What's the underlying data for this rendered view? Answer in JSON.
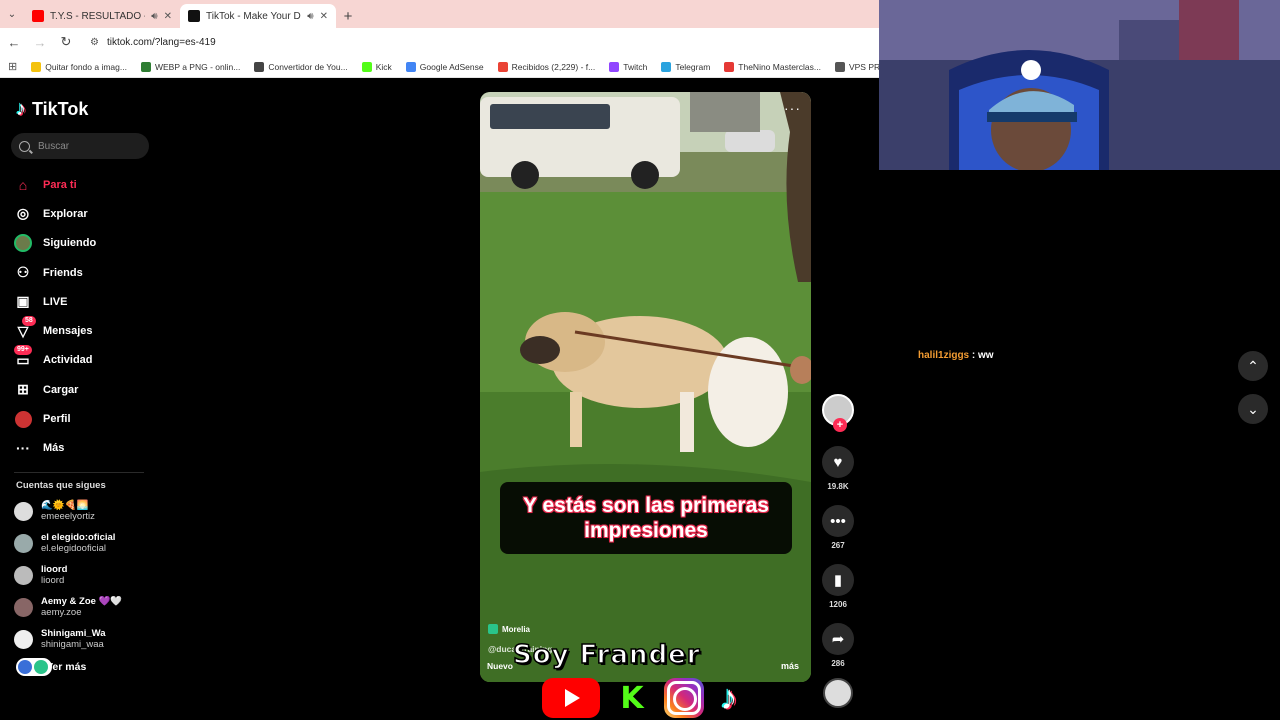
{
  "browser": {
    "tabs": [
      {
        "title": "T.Y.S - RESULTADO - YouTube",
        "icon": "youtube-icon",
        "audio": true,
        "active": false
      },
      {
        "title": "TikTok - Make Your Day",
        "icon": "tiktok-icon",
        "audio": true,
        "active": true
      }
    ],
    "url": "tiktok.com/?lang=es-419",
    "bookmarks": [
      {
        "label": "Quitar fondo a imag...",
        "color": "#f4c20d"
      },
      {
        "label": "WEBP a PNG - onlin...",
        "color": "#2e7d32"
      },
      {
        "label": "Convertidor de You...",
        "color": "#444444"
      },
      {
        "label": "Kick",
        "color": "#53fc18"
      },
      {
        "label": "Google AdSense",
        "color": "#4285f4"
      },
      {
        "label": "Recibidos (2,229) - f...",
        "color": "#ea4335"
      },
      {
        "label": "Twitch",
        "color": "#9146ff"
      },
      {
        "label": "Telegram",
        "color": "#2aa3df"
      },
      {
        "label": "TheNino Masterclas...",
        "color": "#e53935"
      },
      {
        "label": "VPS PRO - ColdHost...",
        "color": "#555555"
      }
    ]
  },
  "sidebar": {
    "logo": "TikTok",
    "search_placeholder": "Buscar",
    "nav": [
      {
        "label": "Para ti",
        "icon": "home-icon",
        "active": true
      },
      {
        "label": "Explorar",
        "icon": "compass-icon"
      },
      {
        "label": "Siguiendo",
        "icon": "following-avatar-icon"
      },
      {
        "label": "Friends",
        "icon": "friends-icon"
      },
      {
        "label": "LIVE",
        "icon": "live-icon"
      },
      {
        "label": "Mensajes",
        "icon": "messages-icon",
        "badge": "58"
      },
      {
        "label": "Actividad",
        "icon": "activity-icon",
        "badge": "99+"
      },
      {
        "label": "Cargar",
        "icon": "upload-icon"
      },
      {
        "label": "Perfil",
        "icon": "profile-icon"
      },
      {
        "label": "Más",
        "icon": "more-icon"
      }
    ],
    "following_title": "Cuentas que sigues",
    "following": [
      {
        "name": "🌊🌞🍕🌅",
        "handle": "emeeelyortiz"
      },
      {
        "name": "el elegido:oficial",
        "handle": "el.elegidooficial"
      },
      {
        "name": "lioord",
        "handle": "lioord"
      },
      {
        "name": "Aemy & Zoe 💜🤍",
        "handle": "aemy.zoe"
      },
      {
        "name": "Shinigami_Wa",
        "handle": "shinigami_waa"
      }
    ],
    "see_more": "Ver más"
  },
  "video": {
    "caption": "Y estás son las primeras impresiones",
    "location": "Morelia",
    "handle": "@ducantraining",
    "description": "Nuevo",
    "more": "más",
    "likes": "19.8K",
    "comments": "267",
    "saves": "1206",
    "shares": "286"
  },
  "stream_overlay": {
    "chat_user": "halil1ziggs",
    "chat_message": ": ww",
    "name_overlay": "Soy Frander"
  },
  "colors": {
    "accent": "#fe2c55",
    "chat_user": "#f39c32",
    "tab_bar": "#f7d6d3"
  }
}
